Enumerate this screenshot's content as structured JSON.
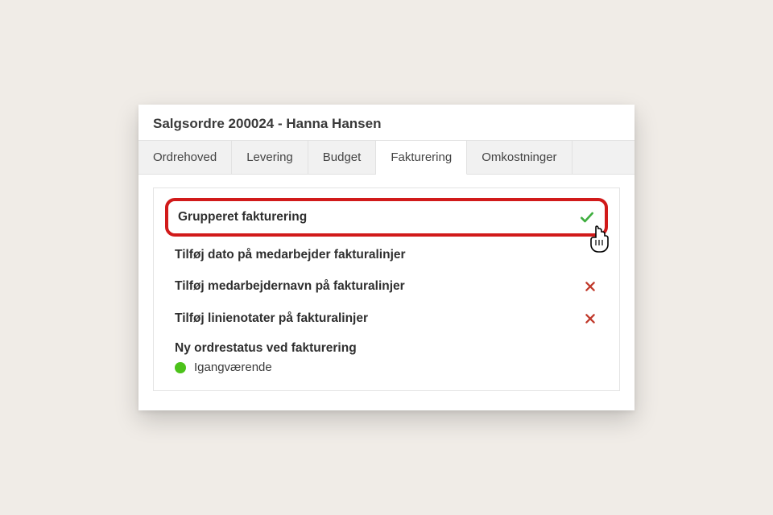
{
  "title": "Salgsordre 200024 - Hanna Hansen",
  "tabs": [
    {
      "label": "Ordrehoved",
      "active": false
    },
    {
      "label": "Levering",
      "active": false
    },
    {
      "label": "Budget",
      "active": false
    },
    {
      "label": "Fakturering",
      "active": true
    },
    {
      "label": "Omkostninger",
      "active": false
    }
  ],
  "rows": [
    {
      "label": "Grupperet fakturering",
      "state": "check",
      "highlight": true
    },
    {
      "label": "Tilføj dato på medarbejder fakturalinjer",
      "state": "none"
    },
    {
      "label": "Tilføj medarbejdernavn på fakturalinjer",
      "state": "cross"
    },
    {
      "label": "Tilføj linienotater på fakturalinjer",
      "state": "cross"
    }
  ],
  "status": {
    "label": "Ny ordrestatus ved fakturering",
    "value": "Igangværende",
    "color": "#4cc21a"
  }
}
